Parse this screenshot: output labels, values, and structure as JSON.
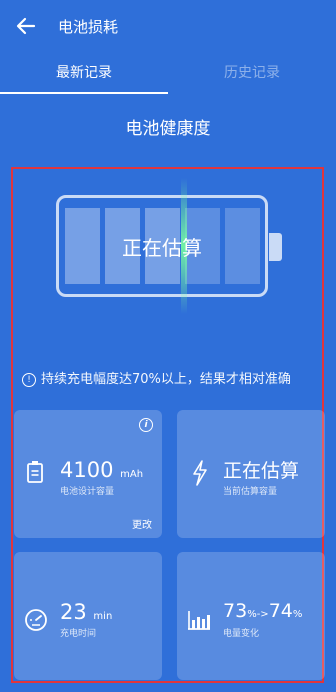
{
  "header": {
    "title": "电池损耗"
  },
  "tabs": [
    {
      "label": "最新记录",
      "active": true
    },
    {
      "label": "历史记录",
      "active": false
    }
  ],
  "section_title": "电池健康度",
  "battery": {
    "status": "正在估算"
  },
  "notice": "持续充电幅度达70%以上，结果才相对准确",
  "cards": {
    "design_capacity": {
      "value": "4100",
      "unit": "mAh",
      "label": "电池设计容量",
      "edit": "更改"
    },
    "current_capacity": {
      "value": "正在估算",
      "label": "当前估算容量"
    },
    "charge_time": {
      "value": "23",
      "unit": "min",
      "label": "充电时间"
    },
    "charge_change": {
      "from": "73",
      "to": "74",
      "unit": "%",
      "arrow": "->",
      "label": "电量变化"
    }
  },
  "colors": {
    "background": "#2f6fd9",
    "highlight_border": "#e0353d"
  }
}
